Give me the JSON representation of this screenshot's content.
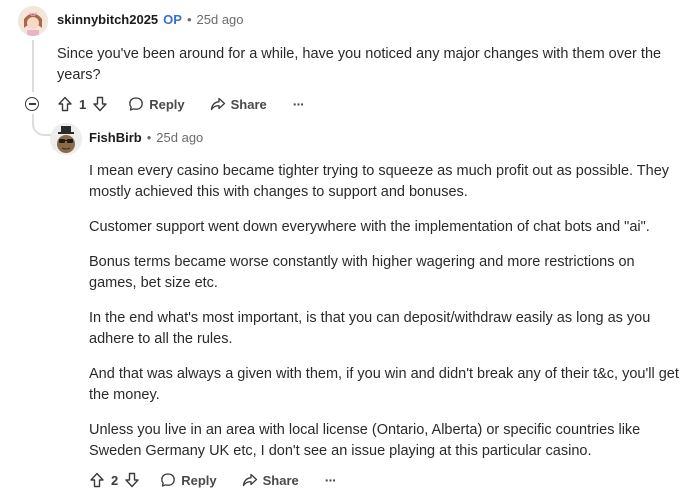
{
  "comments": [
    {
      "author": "skinnybitch2025",
      "op_badge": "OP",
      "time": "25d ago",
      "paragraphs": [
        "Since you've been around for a while, have you noticed any major changes with them over the years?"
      ],
      "score": "1",
      "reply_label": "Reply",
      "share_label": "Share",
      "more_label": "···"
    },
    {
      "author": "FishBirb",
      "time": "25d ago",
      "paragraphs": [
        "I mean every casino became tighter trying to squeeze as much profit out as possible. They mostly achieved this with changes to support and bonuses.",
        "Customer support went down everywhere with the implementation of chat bots and \"ai\".",
        "Bonus terms became worse constantly with higher wagering and more restrictions on games, bet size etc.",
        "In the end what's most important, is that you can deposit/withdraw easily as long as you adhere to all the rules.",
        "And that was always a given with them, if you win and didn't break any of their t&c, you'll get the money.",
        "Unless you live in an area with local license (Ontario, Alberta) or specific countries like Sweden Germany UK etc, I don't see an issue playing at this particular casino."
      ],
      "score": "2",
      "reply_label": "Reply",
      "share_label": "Share",
      "more_label": "···"
    }
  ],
  "separator": "•"
}
